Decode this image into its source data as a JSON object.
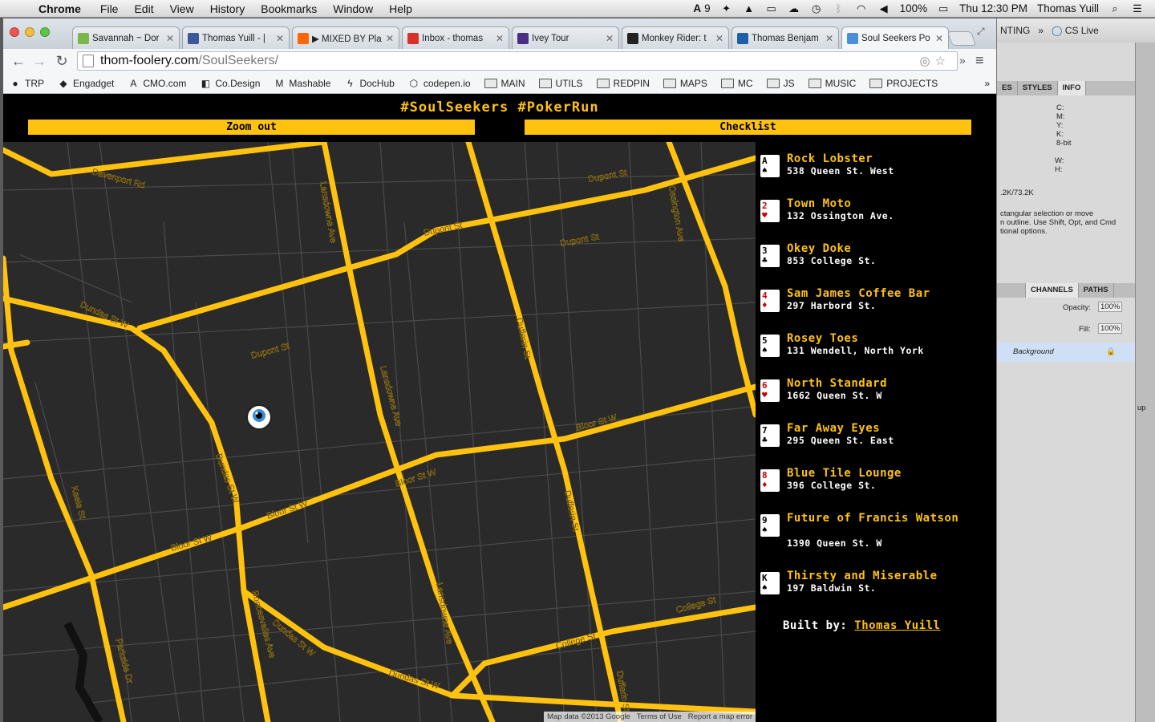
{
  "menubar": {
    "app": "Chrome",
    "items": [
      "File",
      "Edit",
      "View",
      "History",
      "Bookmarks",
      "Window",
      "Help"
    ],
    "adobe_count": "9",
    "battery": "100%",
    "clock": "Thu 12:30 PM",
    "user": "Thomas Yuill"
  },
  "tabs": [
    {
      "title": "Savannah ~ Dor",
      "icon_color": "#7ab648",
      "icon": "document-icon"
    },
    {
      "title": "Thomas Yuill - |",
      "icon_color": "#3b5998",
      "icon": "facebook-icon"
    },
    {
      "title": "▶ MIXED BY Pla",
      "icon_color": "#ff6600",
      "icon": "soundcloud-icon"
    },
    {
      "title": "Inbox - thomas",
      "icon_color": "#d93025",
      "icon": "gmail-icon"
    },
    {
      "title": "Ivey Tour",
      "icon_color": "#4b2e83",
      "icon": "shield-icon"
    },
    {
      "title": "Monkey Rider: t",
      "icon_color": "#222222",
      "icon": "mr-icon"
    },
    {
      "title": "Thomas Benjam",
      "icon_color": "#1d5fa8",
      "icon": "camera-icon"
    },
    {
      "title": "Soul Seekers Po",
      "icon_color": "#4a90d9",
      "icon": "page-icon"
    }
  ],
  "url": {
    "host": "thom-foolery.com",
    "path": "/SoulSeekers/"
  },
  "bookmarks": [
    {
      "label": "TRP",
      "type": "pin"
    },
    {
      "label": "Engadget",
      "type": "rss"
    },
    {
      "label": "CMO.com",
      "type": "adobe"
    },
    {
      "label": "Co.Design",
      "type": "codesign"
    },
    {
      "label": "Mashable",
      "type": "m"
    },
    {
      "label": "DocHub",
      "type": "bolt"
    },
    {
      "label": "codepen.io",
      "type": "codepen"
    },
    {
      "label": "MAIN",
      "type": "folder"
    },
    {
      "label": "UTILS",
      "type": "folder"
    },
    {
      "label": "REDPIN",
      "type": "folder"
    },
    {
      "label": "MAPS",
      "type": "folder"
    },
    {
      "label": "MC",
      "type": "folder"
    },
    {
      "label": "JS",
      "type": "folder"
    },
    {
      "label": "MUSIC",
      "type": "folder"
    },
    {
      "label": "PROJECTS",
      "type": "folder"
    }
  ],
  "site": {
    "title": "#SoulSeekers #PokerRun",
    "zoom_label": "Zoom out",
    "checklist_label": "Checklist",
    "built_by": "Built by:",
    "author": "Thomas Yuill",
    "accent": "#ffc20e"
  },
  "map": {
    "attribution": "Map data ©2013 Google",
    "terms": "Terms of Use",
    "report": "Report a map error",
    "street_labels": [
      "Davenport Rd",
      "Dupont St",
      "Dupont St",
      "Dupont St",
      "Dupont St",
      "Lansdowne Ave",
      "Lansdowne Ave",
      "Lansdowne Ave",
      "Ossington Ave",
      "Dufferin St",
      "Dufferin St",
      "Dufferin St",
      "Dundas St W",
      "Dundas St W",
      "Dundas St W",
      "Dundas St W",
      "Bloor St W",
      "Bloor St W",
      "Bloor St W",
      "Bloor St W",
      "Keele St",
      "Parkside Dr",
      "Roncesvalles Ave",
      "College St",
      "College St"
    ]
  },
  "stops": [
    {
      "card": "A",
      "suit": "♠",
      "red": false,
      "name": "Rock Lobster",
      "address": "538 Queen St. West"
    },
    {
      "card": "2",
      "suit": "♥",
      "red": true,
      "name": "Town Moto",
      "address": "132 Ossington Ave."
    },
    {
      "card": "3",
      "suit": "♣",
      "red": false,
      "name": "Okey Doke",
      "address": "853 College St."
    },
    {
      "card": "4",
      "suit": "♦",
      "red": true,
      "name": "Sam James Coffee Bar",
      "address": "297 Harbord St."
    },
    {
      "card": "5",
      "suit": "♠",
      "red": false,
      "name": "Rosey Toes",
      "address": "131 Wendell, North York"
    },
    {
      "card": "6",
      "suit": "♥",
      "red": true,
      "name": "North Standard",
      "address": "1662 Queen St. W"
    },
    {
      "card": "7",
      "suit": "♣",
      "red": false,
      "name": "Far Away Eyes",
      "address": "295 Queen St. East"
    },
    {
      "card": "8",
      "suit": "♦",
      "red": true,
      "name": "Blue Tile Lounge",
      "address": "396 College St."
    },
    {
      "card": "9",
      "suit": "♠",
      "red": false,
      "name": "Future of Francis Watson",
      "address": "1390 Queen St. W"
    },
    {
      "card": "K",
      "suit": "♠",
      "red": false,
      "name": "Thirsty and Miserable",
      "address": "197 Baldwin St."
    }
  ],
  "photoshop": {
    "top_label": "NTING",
    "cs_live": "CS Live",
    "tabs": [
      "ES",
      "STYLES",
      "INFO"
    ],
    "info_lines": [
      "C:",
      "M:",
      "Y:",
      "K:",
      "8-bit"
    ],
    "wh": [
      "W:",
      "H:"
    ],
    "doc_size": ".2K/73.2K",
    "hint": "ctangular selection or move\nn outline.  Use Shift, Opt, and Cmd\ntional options.",
    "panel_tabs": [
      "CHANNELS",
      "PATHS"
    ],
    "opacity_label": "Opacity:",
    "opacity": "100%",
    "fill_label": "Fill:",
    "fill": "100%",
    "layer": "Background",
    "side_label": "up"
  }
}
